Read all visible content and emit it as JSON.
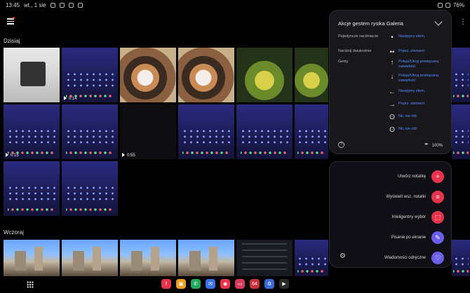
{
  "status": {
    "time": "13:45",
    "date": "wt., 1 sie",
    "battery": "76%"
  },
  "sections": {
    "today": "Dzisiaj",
    "yesterday": "Wczoraj"
  },
  "thumbs": {
    "video1_duration": "0:14",
    "video2_duration": "0:55",
    "video3_duration": "0:15"
  },
  "gesture_panel": {
    "title": "Akcje gestem rysika Galeria",
    "rows": [
      {
        "label": "Pojedyncze naciśnięcie",
        "symbol": "•",
        "action": "Następny elem."
      },
      {
        "label": "Naciśnij dwukrotnie",
        "symbol": "••",
        "action": "Poprz. element"
      },
      {
        "label": "Gesty",
        "symbol": "↑",
        "action": "Pokaż/Ukryj powiązaną zawartość"
      },
      {
        "label": "",
        "symbol": "↓",
        "action": "Pokaż/Ukryj powiązaną zawartość"
      },
      {
        "label": "",
        "symbol": "←",
        "action": "Następny elem."
      },
      {
        "label": "",
        "symbol": "→",
        "action": "Poprz. element"
      },
      {
        "label": "",
        "symbol": "ʘ",
        "action": "Nic nie rób"
      },
      {
        "label": "",
        "symbol": "ʘ",
        "action": "Nic nie rób"
      }
    ],
    "zoom": "100%",
    "help": "?"
  },
  "air_command": {
    "items": [
      {
        "label": "Utwórz notatkę",
        "icon": "+",
        "color": "#e8344a"
      },
      {
        "label": "Wyświetl wsz. notatki",
        "icon": "≡",
        "color": "#e8344a"
      },
      {
        "label": "Inteligentny wybór",
        "icon": "⬚",
        "color": "#e8344a"
      },
      {
        "label": "Pisanie po ekranie",
        "icon": "✎",
        "color": "#6a5fe8"
      },
      {
        "label": "Wiadomości odręczne",
        "icon": "♡",
        "color": "#6a5fe8"
      }
    ]
  },
  "dock": {
    "apps": [
      {
        "name": "flipboard",
        "color": "#e8344a",
        "glyph": "f"
      },
      {
        "name": "folders",
        "color": "#f0a020",
        "glyph": "▣"
      },
      {
        "name": "phone",
        "color": "#22a85a",
        "glyph": "✆"
      },
      {
        "name": "messages",
        "color": "#3a72e8",
        "glyph": "✉"
      },
      {
        "name": "camera",
        "color": "#e8344a",
        "glyph": "◉"
      },
      {
        "name": "screen-recorder",
        "color": "#d83a5a",
        "glyph": "▭"
      },
      {
        "name": "cpu-z",
        "color": "#c8303a",
        "glyph": "64"
      },
      {
        "name": "settings",
        "color": "#3a6ad8",
        "glyph": "⚙"
      },
      {
        "name": "play-store",
        "color": "#2a2a2a",
        "glyph": "▶"
      }
    ]
  }
}
